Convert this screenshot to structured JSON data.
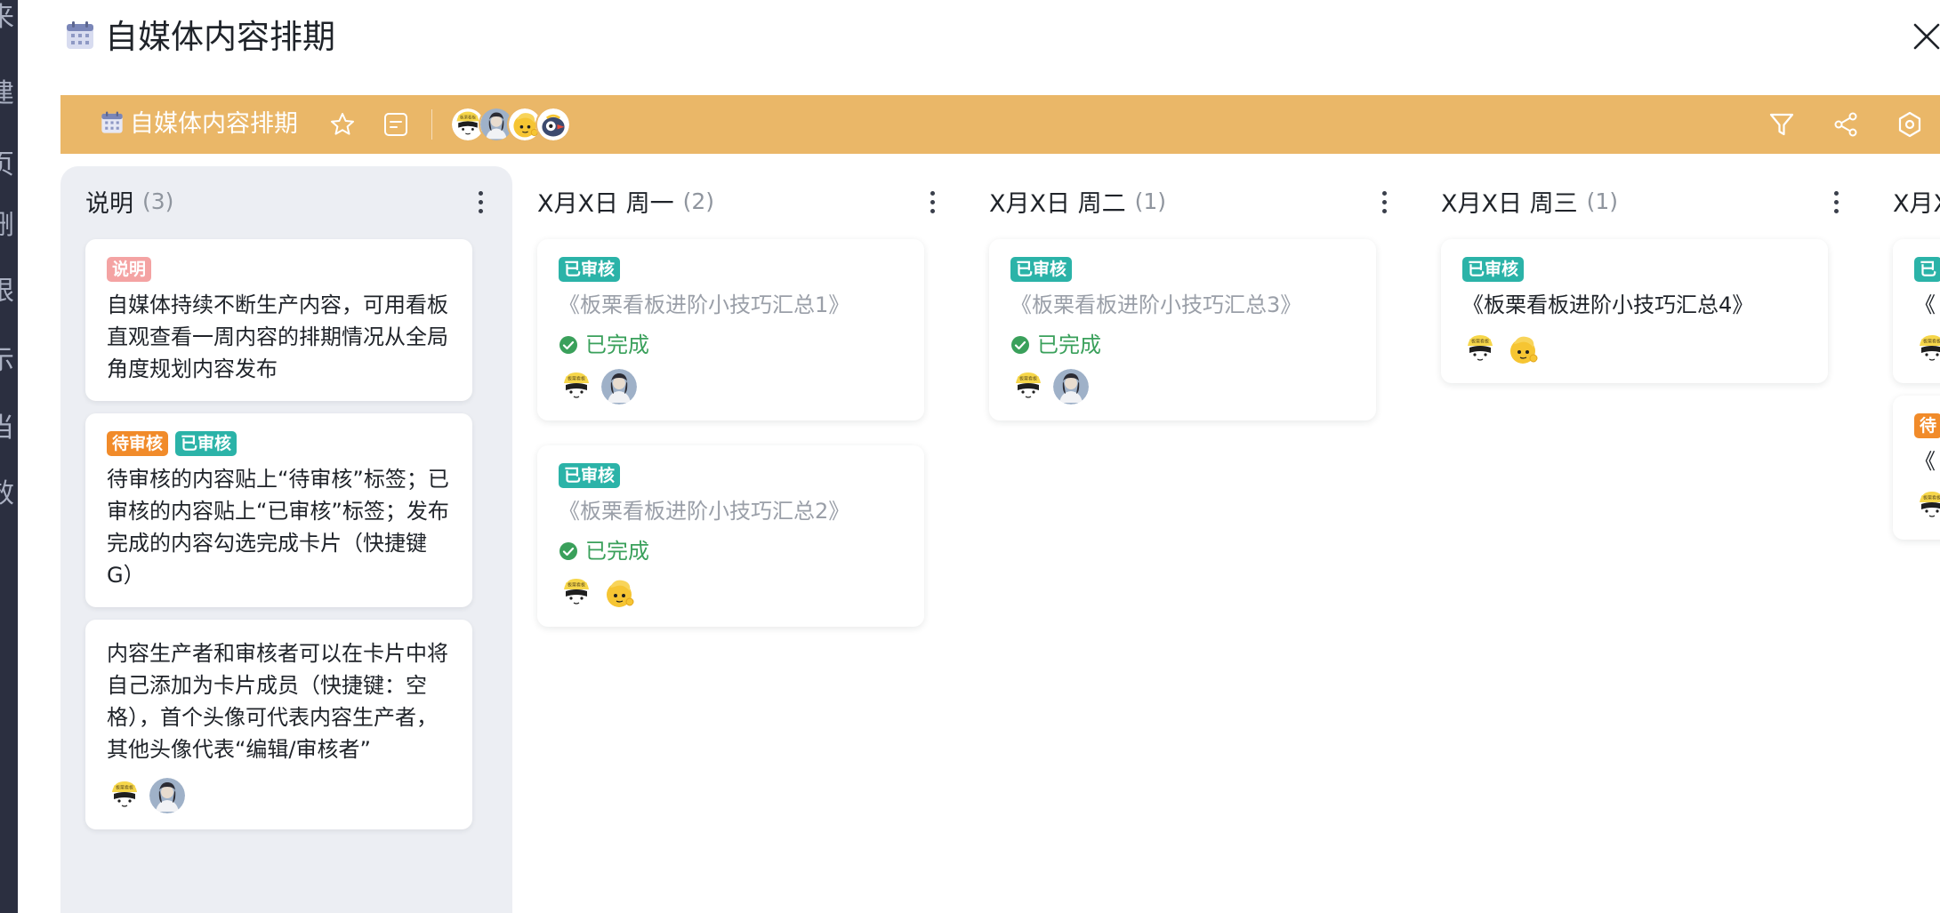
{
  "background_chars": [
    "来",
    "建",
    "页",
    "删",
    "限",
    "示",
    "当",
    "效"
  ],
  "dialog": {
    "title": "自媒体内容排期"
  },
  "toolbar": {
    "board_name": "自媒体内容排期"
  },
  "columns": [
    {
      "title": "说明",
      "count": "(3)",
      "cards": [
        {
          "tags": [
            {
              "label": "说明",
              "color": "#f4a3a3"
            }
          ],
          "text": "自媒体持续不断生产内容，可用看板直观查看一周内容的排期情况从全局角度规划内容发布"
        },
        {
          "tags": [
            {
              "label": "待审核",
              "color": "#f18b2a"
            },
            {
              "label": "已审核",
              "color": "#2bb3a8"
            }
          ],
          "text": "待审核的内容贴上“待审核”标签；已审核的内容贴上“已审核”标签；发布完成的内容勾选完成卡片（快捷键G）"
        },
        {
          "text": "内容生产者和审核者可以在卡片中将自己添加为卡片成员（快捷键：空格），首个头像可代表内容生产者，其他头像代表“编辑/审核者”"
        }
      ]
    },
    {
      "title": "X月X日 周一",
      "count": "(2)",
      "cards": [
        {
          "tags": [
            {
              "label": "已审核",
              "color": "#2bb3a8"
            }
          ],
          "text": "《板栗看板进阶小技巧汇总1》",
          "status": "已完成"
        },
        {
          "tags": [
            {
              "label": "已审核",
              "color": "#2bb3a8"
            }
          ],
          "text": "《板栗看板进阶小技巧汇总2》",
          "status": "已完成"
        }
      ]
    },
    {
      "title": "X月X日 周二",
      "count": "(1)",
      "cards": [
        {
          "tags": [
            {
              "label": "已审核",
              "color": "#2bb3a8"
            }
          ],
          "text": "《板栗看板进阶小技巧汇总3》",
          "status": "已完成"
        }
      ]
    },
    {
      "title": "X月X日 周三",
      "count": "(1)",
      "cards": [
        {
          "tags": [
            {
              "label": "已审核",
              "color": "#2bb3a8"
            }
          ],
          "text": "《板栗看板进阶小技巧汇总4》"
        }
      ]
    },
    {
      "title": "X月X",
      "cards": [
        {
          "tags": [
            {
              "label": "已",
              "color": "#2bb3a8"
            }
          ],
          "text": "《"
        },
        {
          "tags": [
            {
              "label": "待",
              "color": "#f18b2a"
            }
          ],
          "text": "《"
        }
      ]
    }
  ],
  "colors": {
    "toolbar": "#eab768",
    "desc_column": "#eceef3",
    "done_green": "#3aa05b",
    "tag_teal": "#2bb3a8",
    "tag_orange": "#f18b2a",
    "tag_red": "#f4a3a3"
  },
  "icons": {
    "title": "calendar-icon",
    "close": "close-icon",
    "star": "star-icon",
    "description": "description-icon",
    "filter": "filter-icon",
    "share": "share-icon",
    "settings": "settings-icon",
    "menu": "more-vertical-icon",
    "done": "check-circle-icon",
    "avatar_a": "cartoon-girl-avatar",
    "avatar_b": "photo-avatar",
    "avatar_c": "yellow-cartoon-avatar"
  }
}
